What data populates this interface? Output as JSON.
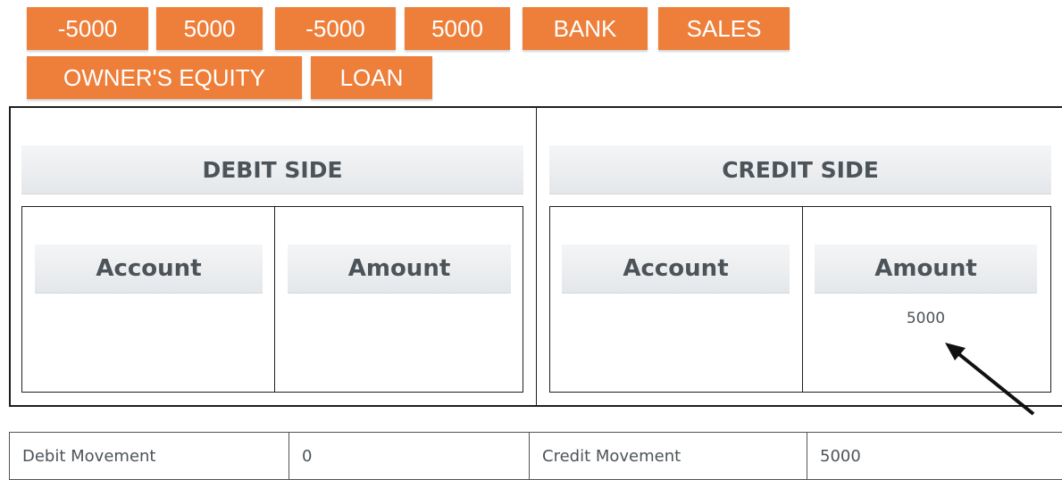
{
  "chips": [
    {
      "label": "-5000"
    },
    {
      "label": "5000"
    },
    {
      "label": "-5000"
    },
    {
      "label": "5000"
    },
    {
      "label": "BANK"
    },
    {
      "label": "SALES"
    },
    {
      "label": "OWNER'S EQUITY"
    },
    {
      "label": "LOAN"
    }
  ],
  "debit": {
    "title": "DEBIT SIDE",
    "account_header": "Account",
    "amount_header": "Amount",
    "amount_value": ""
  },
  "credit": {
    "title": "CREDIT SIDE",
    "account_header": "Account",
    "amount_header": "Amount",
    "amount_value": "5000"
  },
  "summary": {
    "debit_label": "Debit Movement",
    "debit_value": "0",
    "credit_label": "Credit Movement",
    "credit_value": "5000"
  },
  "colors": {
    "chip": "#ee7f3a",
    "header_text": "#4c5459"
  }
}
